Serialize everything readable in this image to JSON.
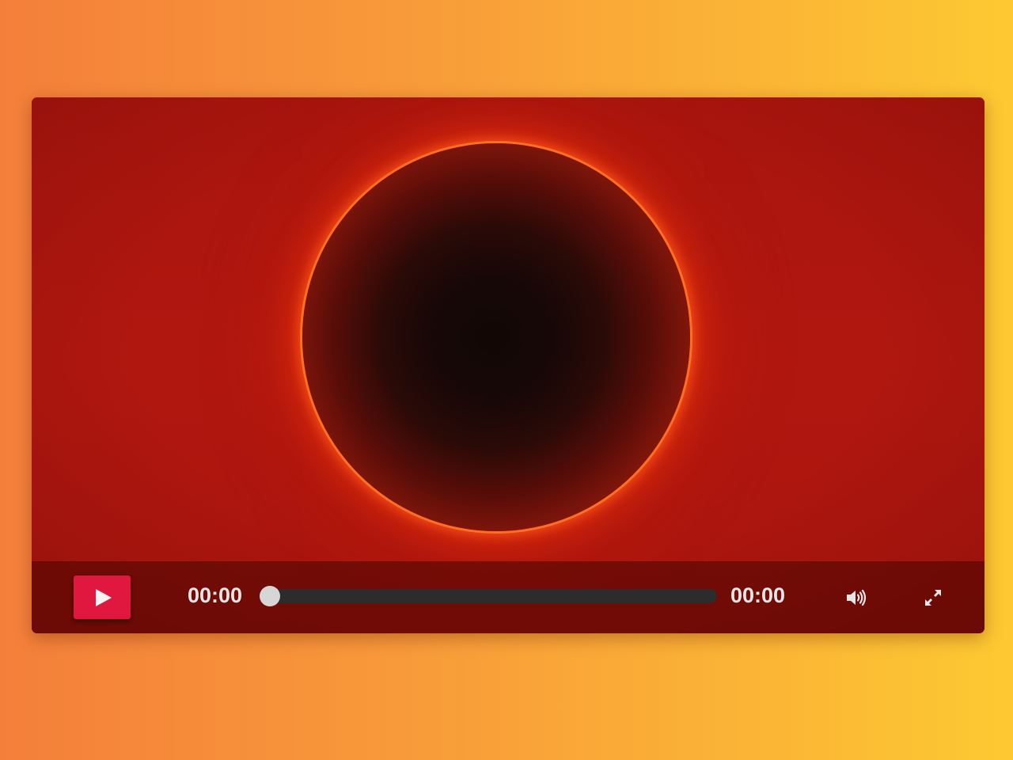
{
  "player": {
    "current_time": "00:00",
    "duration": "00:00",
    "progress_fraction": 0,
    "colors": {
      "accent": "#e0173f",
      "control_text": "#e6e6e6",
      "track": "#2c2c2c",
      "thumb": "#d6d6d6"
    },
    "icons": {
      "play": "play-icon",
      "volume": "volume-icon",
      "fullscreen": "fullscreen-expand-icon"
    }
  }
}
